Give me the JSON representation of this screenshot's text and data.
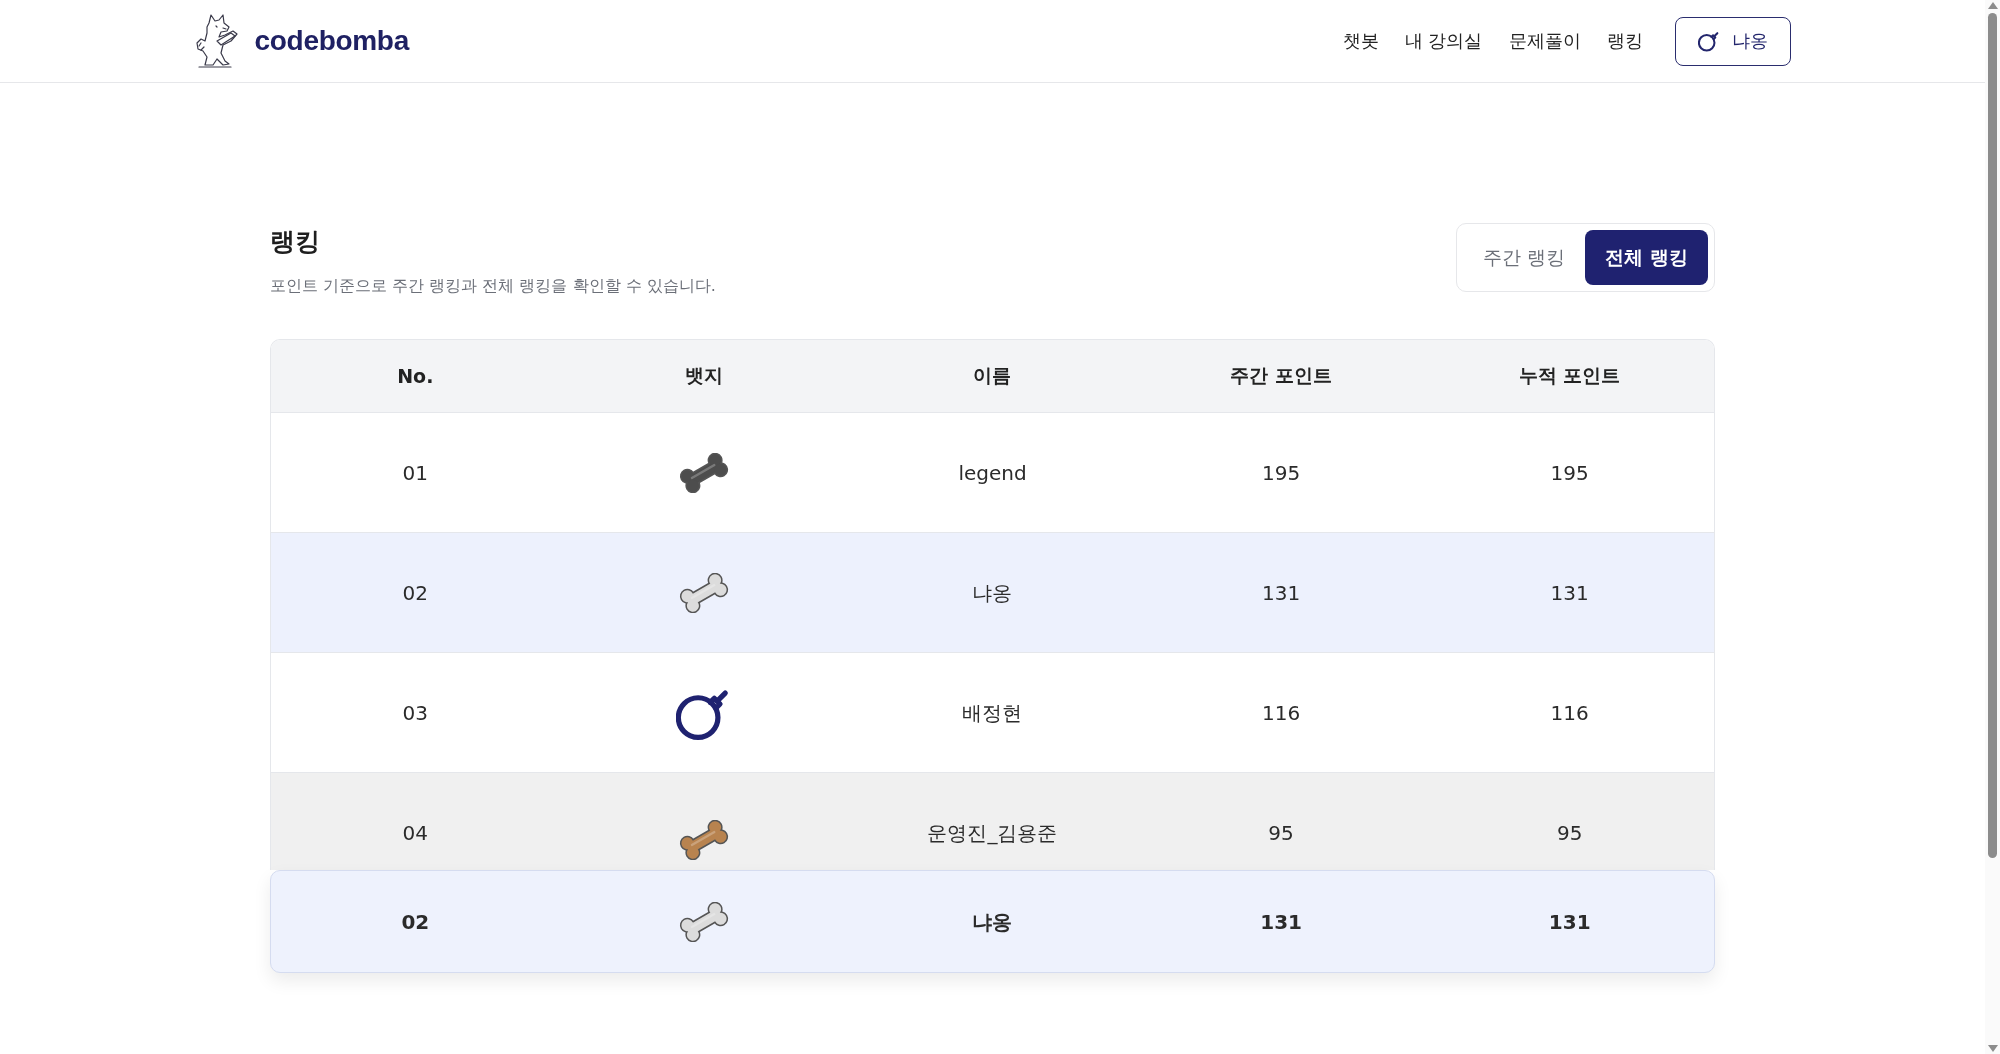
{
  "header": {
    "logo_text": "codebomba",
    "nav": [
      "챗봇",
      "내 강의실",
      "문제풀이",
      "랭킹"
    ],
    "user_button": {
      "label": "냐옹"
    }
  },
  "ranking": {
    "title": "랭킹",
    "subtitle": "포인트 기준으로 주간 랭킹과 전체 랭킹을 확인할 수 있습니다.",
    "tabs": [
      {
        "label": "주간 랭킹",
        "selected": false
      },
      {
        "label": "전체 랭킹",
        "selected": true
      }
    ]
  },
  "table": {
    "columns": [
      "No.",
      "뱃지",
      "이름",
      "주간 포인트",
      "누적 포인트"
    ],
    "rows": [
      {
        "no": "01",
        "badge": {
          "kind": "bone",
          "color": "#4d4d4d"
        },
        "name": "legend",
        "weekly_points": "195",
        "total_points": "195",
        "current_user": false,
        "hovered": false
      },
      {
        "no": "02",
        "badge": {
          "kind": "bone",
          "color": "#dcdcdc"
        },
        "name": "냐옹",
        "weekly_points": "131",
        "total_points": "131",
        "current_user": true,
        "hovered": false
      },
      {
        "no": "03",
        "badge": {
          "kind": "bomb",
          "color": "#1f2270"
        },
        "name": "배정현",
        "weekly_points": "116",
        "total_points": "116",
        "current_user": false,
        "hovered": false
      },
      {
        "no": "04",
        "badge": {
          "kind": "bone",
          "color": "#b8834f"
        },
        "name": "운영진_김용준",
        "weekly_points": "95",
        "total_points": "95",
        "current_user": false,
        "hovered": true
      }
    ]
  },
  "my_rank": {
    "no": "02",
    "badge": {
      "kind": "bone",
      "color": "#dcdcdc"
    },
    "name": "냐옹",
    "weekly_points": "131",
    "total_points": "131"
  }
}
